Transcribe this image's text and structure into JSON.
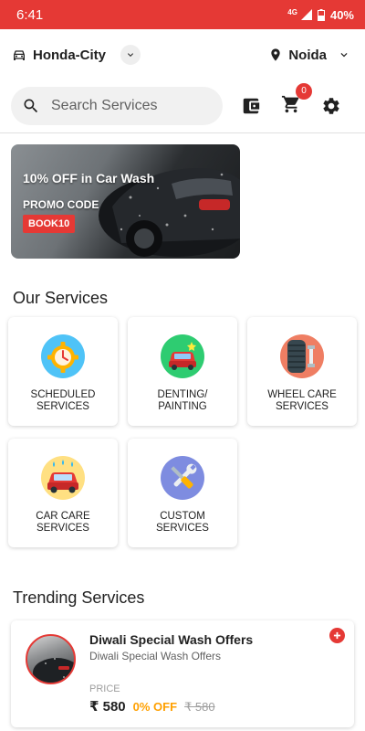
{
  "status_bar": {
    "time": "6:41",
    "network": "4G",
    "battery": "40%"
  },
  "header": {
    "car_name": "Honda-City",
    "city": "Noida",
    "cart_count": "0"
  },
  "search": {
    "placeholder": "Search Services"
  },
  "banner": {
    "title": "10% OFF in Car Wash",
    "promo_label": "PROMO CODE",
    "promo_code": "BOOK10"
  },
  "services": {
    "title": "Our Services",
    "items": [
      {
        "label": "SCHEDULED SERVICES",
        "icon": "scheduled-services-icon"
      },
      {
        "label": "DENTING/ PAINTING",
        "icon": "denting-painting-icon"
      },
      {
        "label": "WHEEL CARE SERVICES",
        "icon": "wheel-care-icon"
      },
      {
        "label": "CAR CARE SERVICES",
        "icon": "car-care-icon"
      },
      {
        "label": "CUSTOM SERVICES",
        "icon": "custom-services-icon"
      }
    ]
  },
  "trending": {
    "title": "Trending Services",
    "items": [
      {
        "title": "Diwali Special Wash Offers",
        "subtitle": "Diwali Special Wash Offers",
        "price_label": "PRICE",
        "price": "₹ 580",
        "discount": "0% OFF",
        "original_price": "₹ 580"
      }
    ]
  },
  "colors": {
    "accent": "#e53935",
    "discount": "#ffa000"
  }
}
